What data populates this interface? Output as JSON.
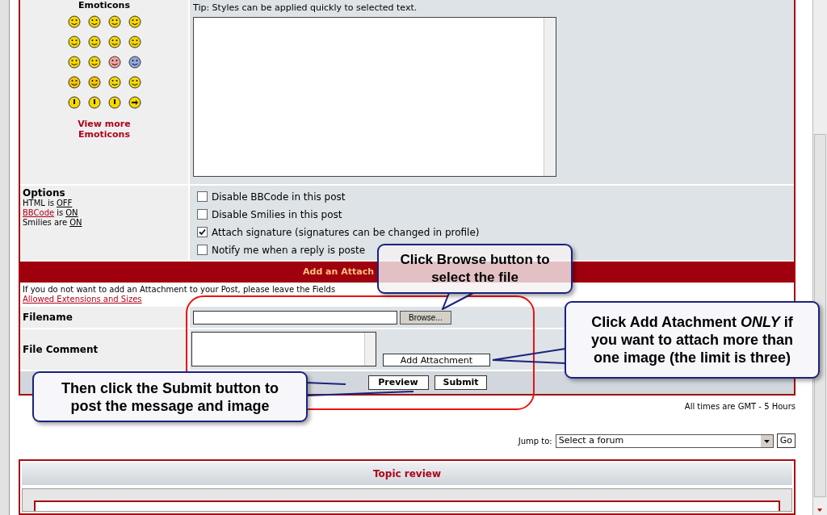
{
  "emoticons_panel": {
    "title": "Emoticons",
    "more_link": "View more Emoticons"
  },
  "message": {
    "tip": "Tip: Styles can be applied quickly to selected text."
  },
  "options": {
    "title": "Options",
    "lines": [
      {
        "kind": "plain",
        "label": "HTML is",
        "status": "OFF"
      },
      {
        "kind": "link",
        "label": "BBCode",
        "suffix": "is",
        "status": "ON"
      },
      {
        "kind": "plain",
        "label": "Smilies are",
        "status": "ON"
      }
    ]
  },
  "checkboxes": [
    {
      "label": "Disable BBCode in this post",
      "checked": false
    },
    {
      "label": "Disable Smilies in this post",
      "checked": false
    },
    {
      "label": "Attach signature (signatures can be changed in profile)",
      "checked": true
    },
    {
      "label": "Notify me when a reply is poste",
      "checked": false
    }
  ],
  "attachment": {
    "header": "Add an Attach",
    "notice": "If you do not want to add an Attachment to your Post, please leave the Fields",
    "link": "Allowed Extensions and Sizes",
    "filename_label": "Filename",
    "browse_button": "Browse...",
    "comment_label": "File Comment",
    "add_button": "Add Attachment"
  },
  "buttons": [
    "Preview",
    "Submit"
  ],
  "footer": {
    "timezone": "All times are GMT - 5 Hours",
    "jump_label": "Jump to:",
    "jump_select": "Select a forum",
    "go_button": "Go"
  },
  "topic_review": {
    "title": "Topic review"
  },
  "callouts": [
    {
      "text": "Click Browse button to select the file"
    },
    {
      "text": "Click Add Atachment *ONLY* if you want to attach more than one image (the limit is three)"
    },
    {
      "text": "Then click the Submit button to post the message and image"
    }
  ]
}
